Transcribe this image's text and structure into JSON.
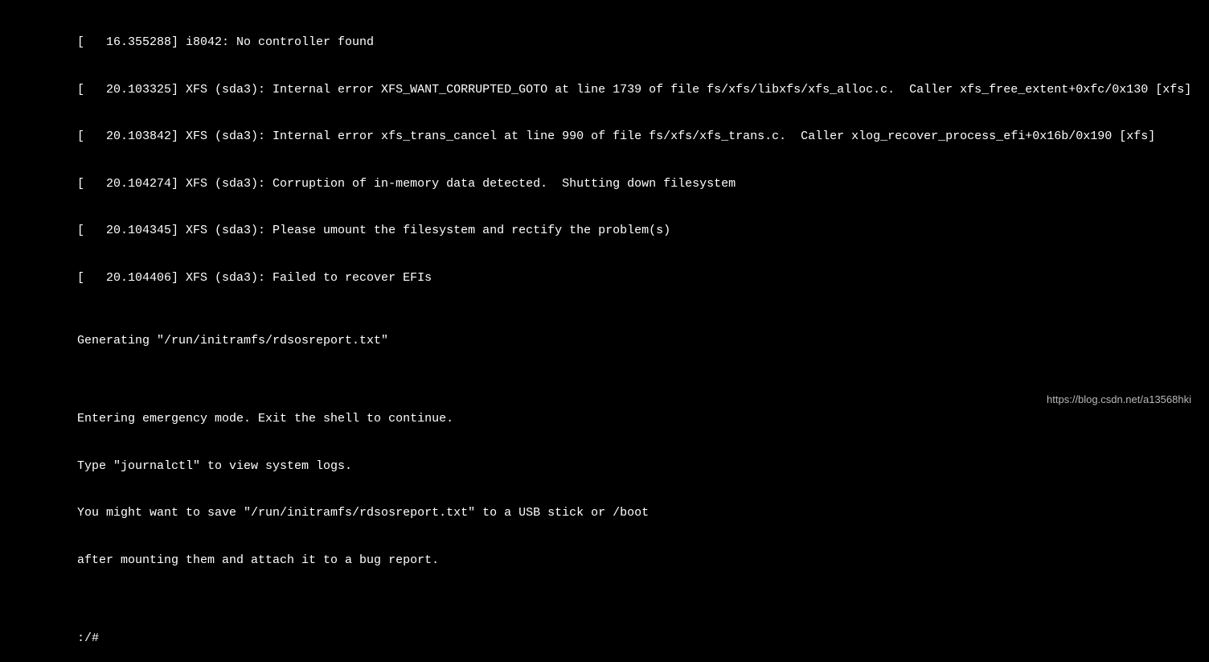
{
  "console": {
    "lines": [
      "[   16.355288] i8042: No controller found",
      "[   20.103325] XFS (sda3): Internal error XFS_WANT_CORRUPTED_GOTO at line 1739 of file fs/xfs/libxfs/xfs_alloc.c.  Caller xfs_free_extent+0xfc/0x130 [xfs]",
      "[   20.103842] XFS (sda3): Internal error xfs_trans_cancel at line 990 of file fs/xfs/xfs_trans.c.  Caller xlog_recover_process_efi+0x16b/0x190 [xfs]",
      "[   20.104274] XFS (sda3): Corruption of in-memory data detected.  Shutting down filesystem",
      "[   20.104345] XFS (sda3): Please umount the filesystem and rectify the problem(s)",
      "[   20.104406] XFS (sda3): Failed to recover EFIs",
      "",
      "Generating \"/run/initramfs/rdsosreport.txt\"",
      "",
      "",
      "Entering emergency mode. Exit the shell to continue.",
      "Type \"journalctl\" to view system logs.",
      "You might want to save \"/run/initramfs/rdsosreport.txt\" to a USB stick or /boot",
      "after mounting them and attach it to a bug report.",
      "",
      ""
    ],
    "prompt": ":/#"
  },
  "watermark": "https://blog.csdn.net/a13568hki"
}
